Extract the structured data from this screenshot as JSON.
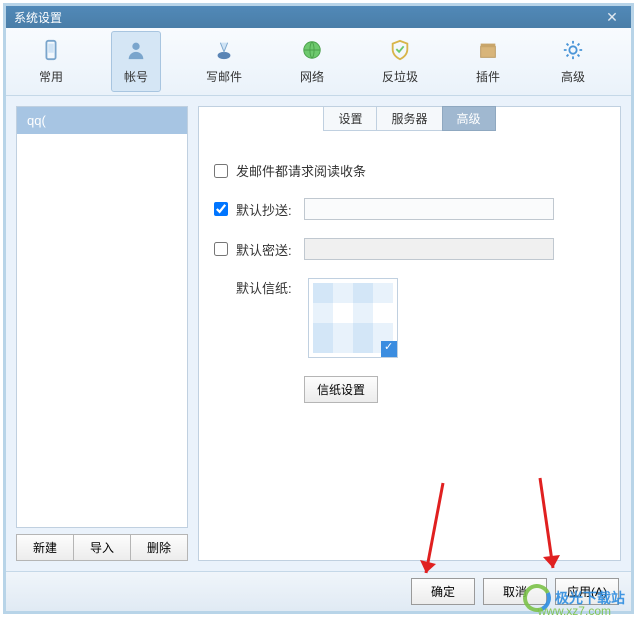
{
  "window": {
    "title": "系统设置"
  },
  "toolbar": {
    "items": [
      {
        "label": "常用"
      },
      {
        "label": "帐号"
      },
      {
        "label": "写邮件"
      },
      {
        "label": "网络"
      },
      {
        "label": "反垃圾"
      },
      {
        "label": "插件"
      },
      {
        "label": "高级"
      }
    ],
    "active_index": 1
  },
  "sidebar": {
    "accounts": [
      {
        "label": "qq("
      }
    ],
    "buttons": {
      "new": "新建",
      "import": "导入",
      "delete": "删除"
    }
  },
  "tabs": {
    "items": [
      "设置",
      "服务器",
      "高级"
    ],
    "active_index": 2
  },
  "form": {
    "read_receipt": {
      "label": "发邮件都请求阅读收条",
      "checked": false
    },
    "cc": {
      "label": "默认抄送:",
      "checked": true,
      "value": ""
    },
    "bcc": {
      "label": "默认密送:",
      "checked": false,
      "value": ""
    },
    "stationery_label": "默认信纸:",
    "stationery_button": "信纸设置"
  },
  "footer": {
    "ok": "确定",
    "cancel": "取消",
    "apply": "应用(A)"
  },
  "watermark": {
    "brand": "极光下载站",
    "url": "www.xz7.com"
  },
  "colors": {
    "accent": "#3b8de0",
    "titlebar": "#4a7ea8"
  }
}
